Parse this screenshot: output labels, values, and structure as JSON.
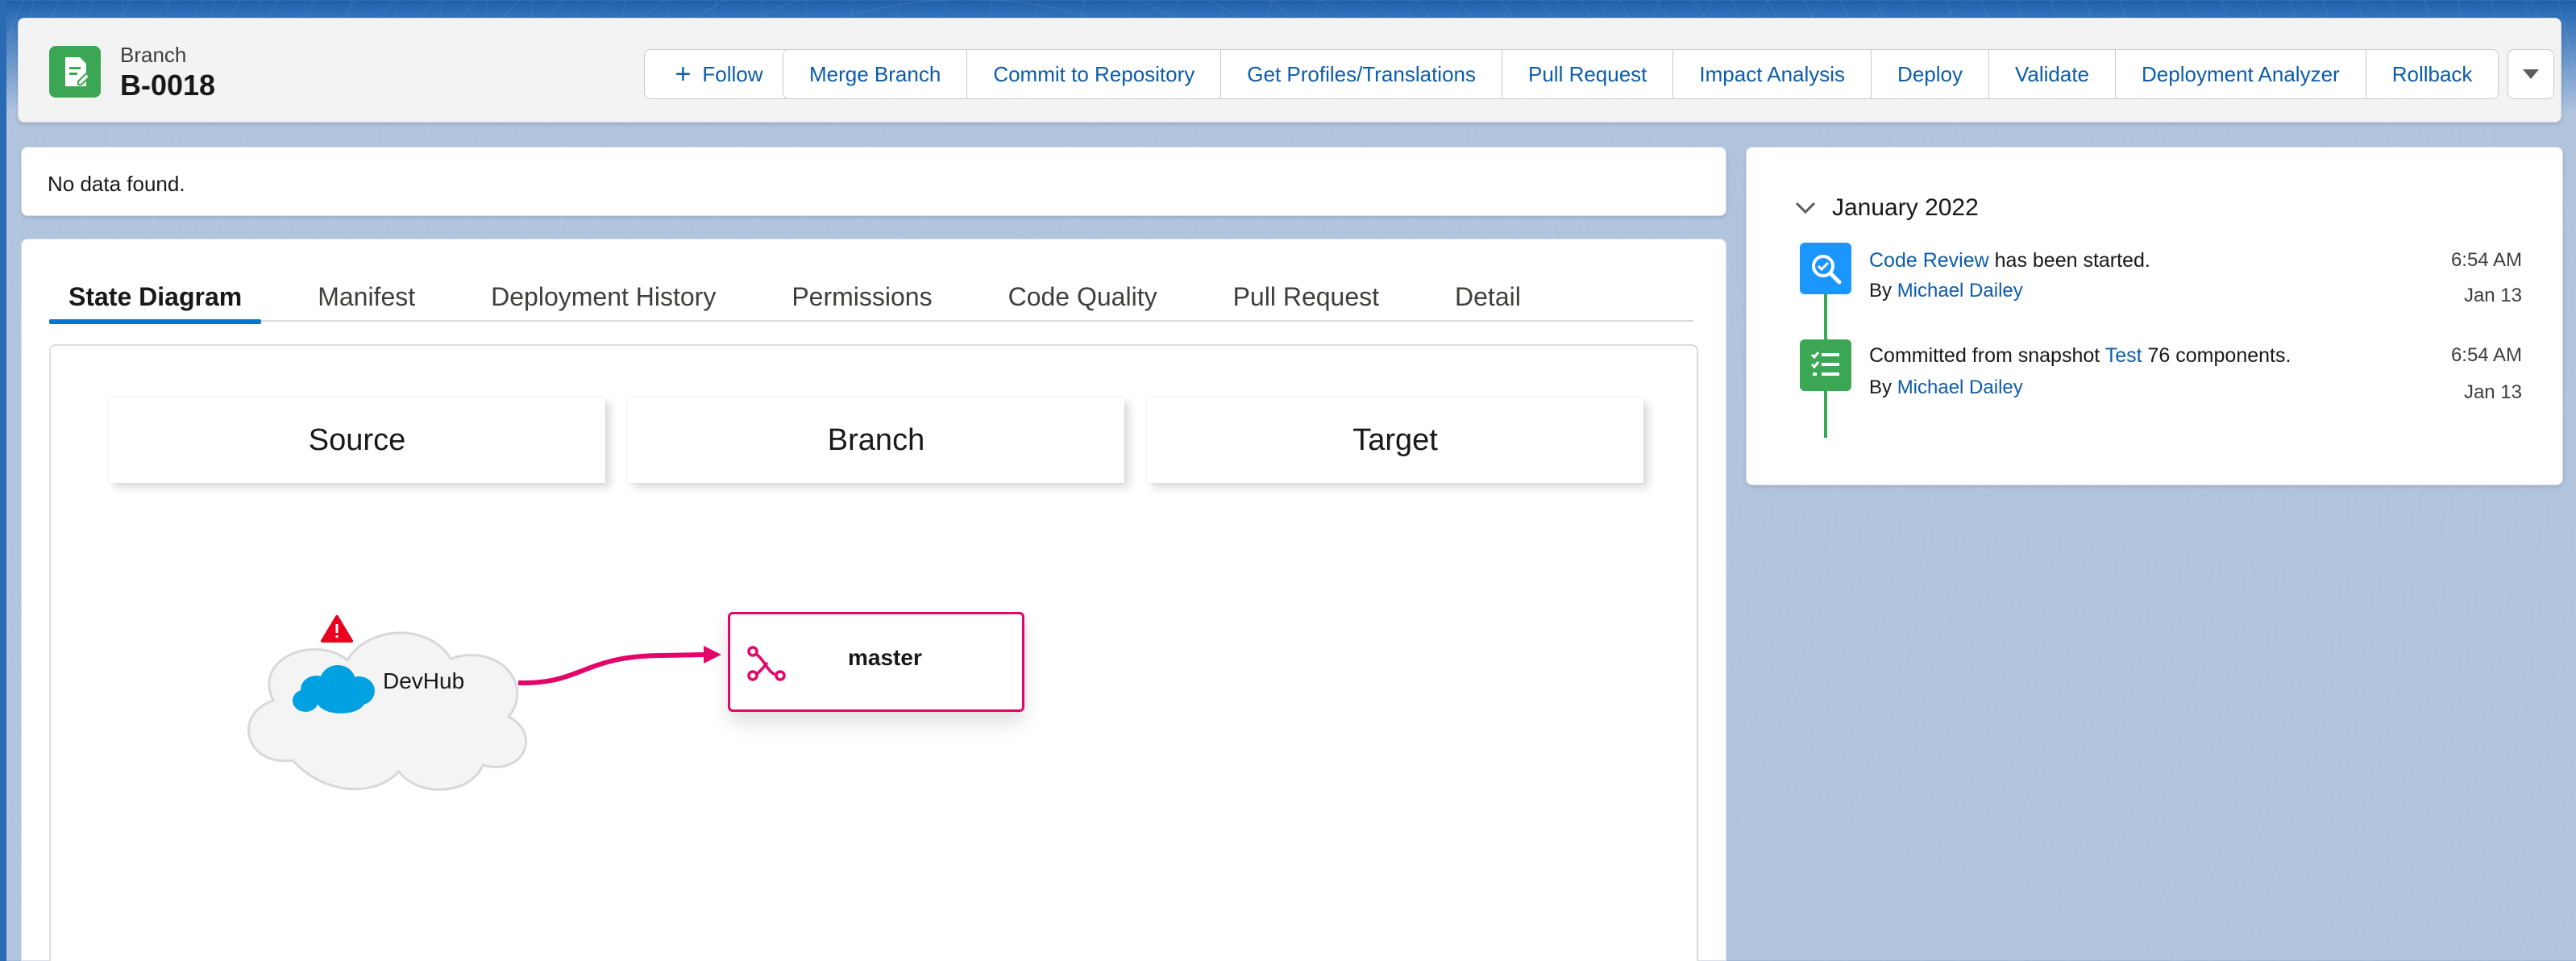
{
  "record": {
    "type": "Branch",
    "name": "B-0018"
  },
  "actions": {
    "follow": "Follow",
    "buttons": [
      "Merge Branch",
      "Commit to Repository",
      "Get Profiles/Translations",
      "Pull Request",
      "Impact Analysis",
      "Deploy",
      "Validate",
      "Deployment Analyzer",
      "Rollback"
    ]
  },
  "notice": "No data found.",
  "tabs": [
    "State Diagram",
    "Manifest",
    "Deployment History",
    "Permissions",
    "Code Quality",
    "Pull Request",
    "Detail"
  ],
  "diagram": {
    "columns": [
      "Source",
      "Branch",
      "Target"
    ],
    "source_org": "DevHub",
    "branch_name": "master"
  },
  "activity": {
    "month": "January 2022",
    "items": [
      {
        "link": "Code Review",
        "text": " has been started.",
        "by_prefix": "By ",
        "by": "Michael Dailey",
        "time": "6:54 AM",
        "date": "Jan 13",
        "icon": "code-review-icon",
        "color": "#1b96ff"
      },
      {
        "prefix": "Committed from snapshot ",
        "link": "Test",
        "text": " 76 components.",
        "by_prefix": "By ",
        "by": "Michael Dailey",
        "time": "6:54 AM",
        "date": "Jan 13",
        "icon": "commit-list-icon",
        "color": "#3ba755"
      }
    ]
  },
  "colors": {
    "brand": "#0176d3",
    "accent_pink": "#e3066a",
    "record_icon": "#3ba755",
    "link": "#0b5cab"
  }
}
